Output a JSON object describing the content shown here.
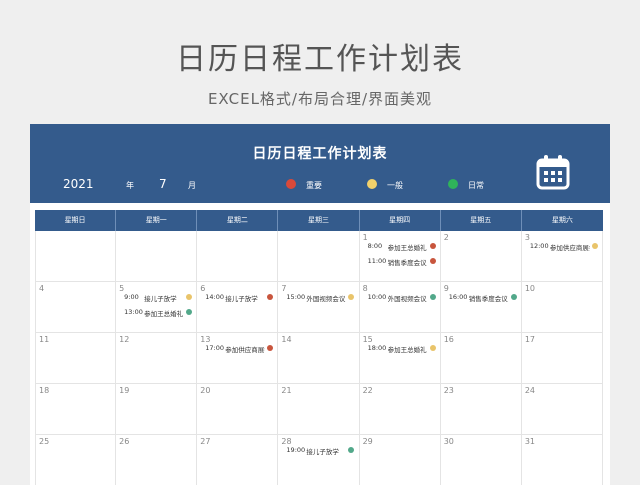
{
  "page": {
    "title": "日历日程工作计划表",
    "subtitle": "EXCEL格式/布局合理/界面美观"
  },
  "header": {
    "title": "日历日程工作计划表",
    "year": "2021",
    "year_unit": "年",
    "month": "7",
    "month_unit": "月",
    "legend": [
      {
        "label": "重要",
        "color": "#d9493a"
      },
      {
        "label": "一般",
        "color": "#f2d16b"
      },
      {
        "label": "日常",
        "color": "#2fb35a"
      }
    ]
  },
  "weekdays": [
    "星期日",
    "星期一",
    "星期二",
    "星期三",
    "星期四",
    "星期五",
    "星期六"
  ],
  "colors": {
    "header_blue": "#345b8c",
    "event_red": "#c8553d",
    "event_yellow": "#e9c46a",
    "event_green": "#52a88a"
  },
  "weeks": [
    [
      {
        "day": "",
        "events": []
      },
      {
        "day": "",
        "events": []
      },
      {
        "day": "",
        "events": []
      },
      {
        "day": "",
        "events": []
      },
      {
        "day": "1",
        "events": [
          {
            "time": "8:00",
            "name": "参加王总婚礼",
            "color": "#c8553d"
          },
          {
            "time": "11:00",
            "name": "销售季度会议",
            "color": "#c8553d"
          }
        ]
      },
      {
        "day": "2",
        "events": []
      },
      {
        "day": "3",
        "events": [
          {
            "time": "12:00",
            "name": "参加供应商展会",
            "color": "#e9c46a"
          }
        ]
      }
    ],
    [
      {
        "day": "4",
        "events": []
      },
      {
        "day": "5",
        "events": [
          {
            "time": "9:00",
            "name": "接儿子放学",
            "color": "#e9c46a"
          },
          {
            "time": "13:00",
            "name": "参加王总婚礼",
            "color": "#52a88a"
          }
        ]
      },
      {
        "day": "6",
        "events": [
          {
            "time": "14:00",
            "name": "接儿子放学",
            "color": "#c8553d"
          }
        ]
      },
      {
        "day": "7",
        "events": [
          {
            "time": "15:00",
            "name": "外国视频会议",
            "color": "#e9c46a"
          }
        ]
      },
      {
        "day": "8",
        "events": [
          {
            "time": "10:00",
            "name": "外国视频会议",
            "color": "#52a88a"
          }
        ]
      },
      {
        "day": "9",
        "events": [
          {
            "time": "16:00",
            "name": "销售季度会议",
            "color": "#52a88a"
          }
        ]
      },
      {
        "day": "10",
        "events": []
      }
    ],
    [
      {
        "day": "11",
        "events": []
      },
      {
        "day": "12",
        "events": []
      },
      {
        "day": "13",
        "events": [
          {
            "time": "17:00",
            "name": "参加供应商展会",
            "color": "#c8553d"
          }
        ]
      },
      {
        "day": "14",
        "events": []
      },
      {
        "day": "15",
        "events": [
          {
            "time": "18:00",
            "name": "参加王总婚礼",
            "color": "#e9c46a"
          }
        ]
      },
      {
        "day": "16",
        "events": []
      },
      {
        "day": "17",
        "events": []
      }
    ],
    [
      {
        "day": "18",
        "events": []
      },
      {
        "day": "19",
        "events": []
      },
      {
        "day": "20",
        "events": []
      },
      {
        "day": "21",
        "events": []
      },
      {
        "day": "22",
        "events": []
      },
      {
        "day": "23",
        "events": []
      },
      {
        "day": "24",
        "events": []
      }
    ],
    [
      {
        "day": "25",
        "events": []
      },
      {
        "day": "26",
        "events": []
      },
      {
        "day": "27",
        "events": []
      },
      {
        "day": "28",
        "events": [
          {
            "time": "19:00",
            "name": "接儿子放学",
            "color": "#52a88a"
          }
        ]
      },
      {
        "day": "29",
        "events": []
      },
      {
        "day": "30",
        "events": []
      },
      {
        "day": "31",
        "events": []
      }
    ]
  ]
}
